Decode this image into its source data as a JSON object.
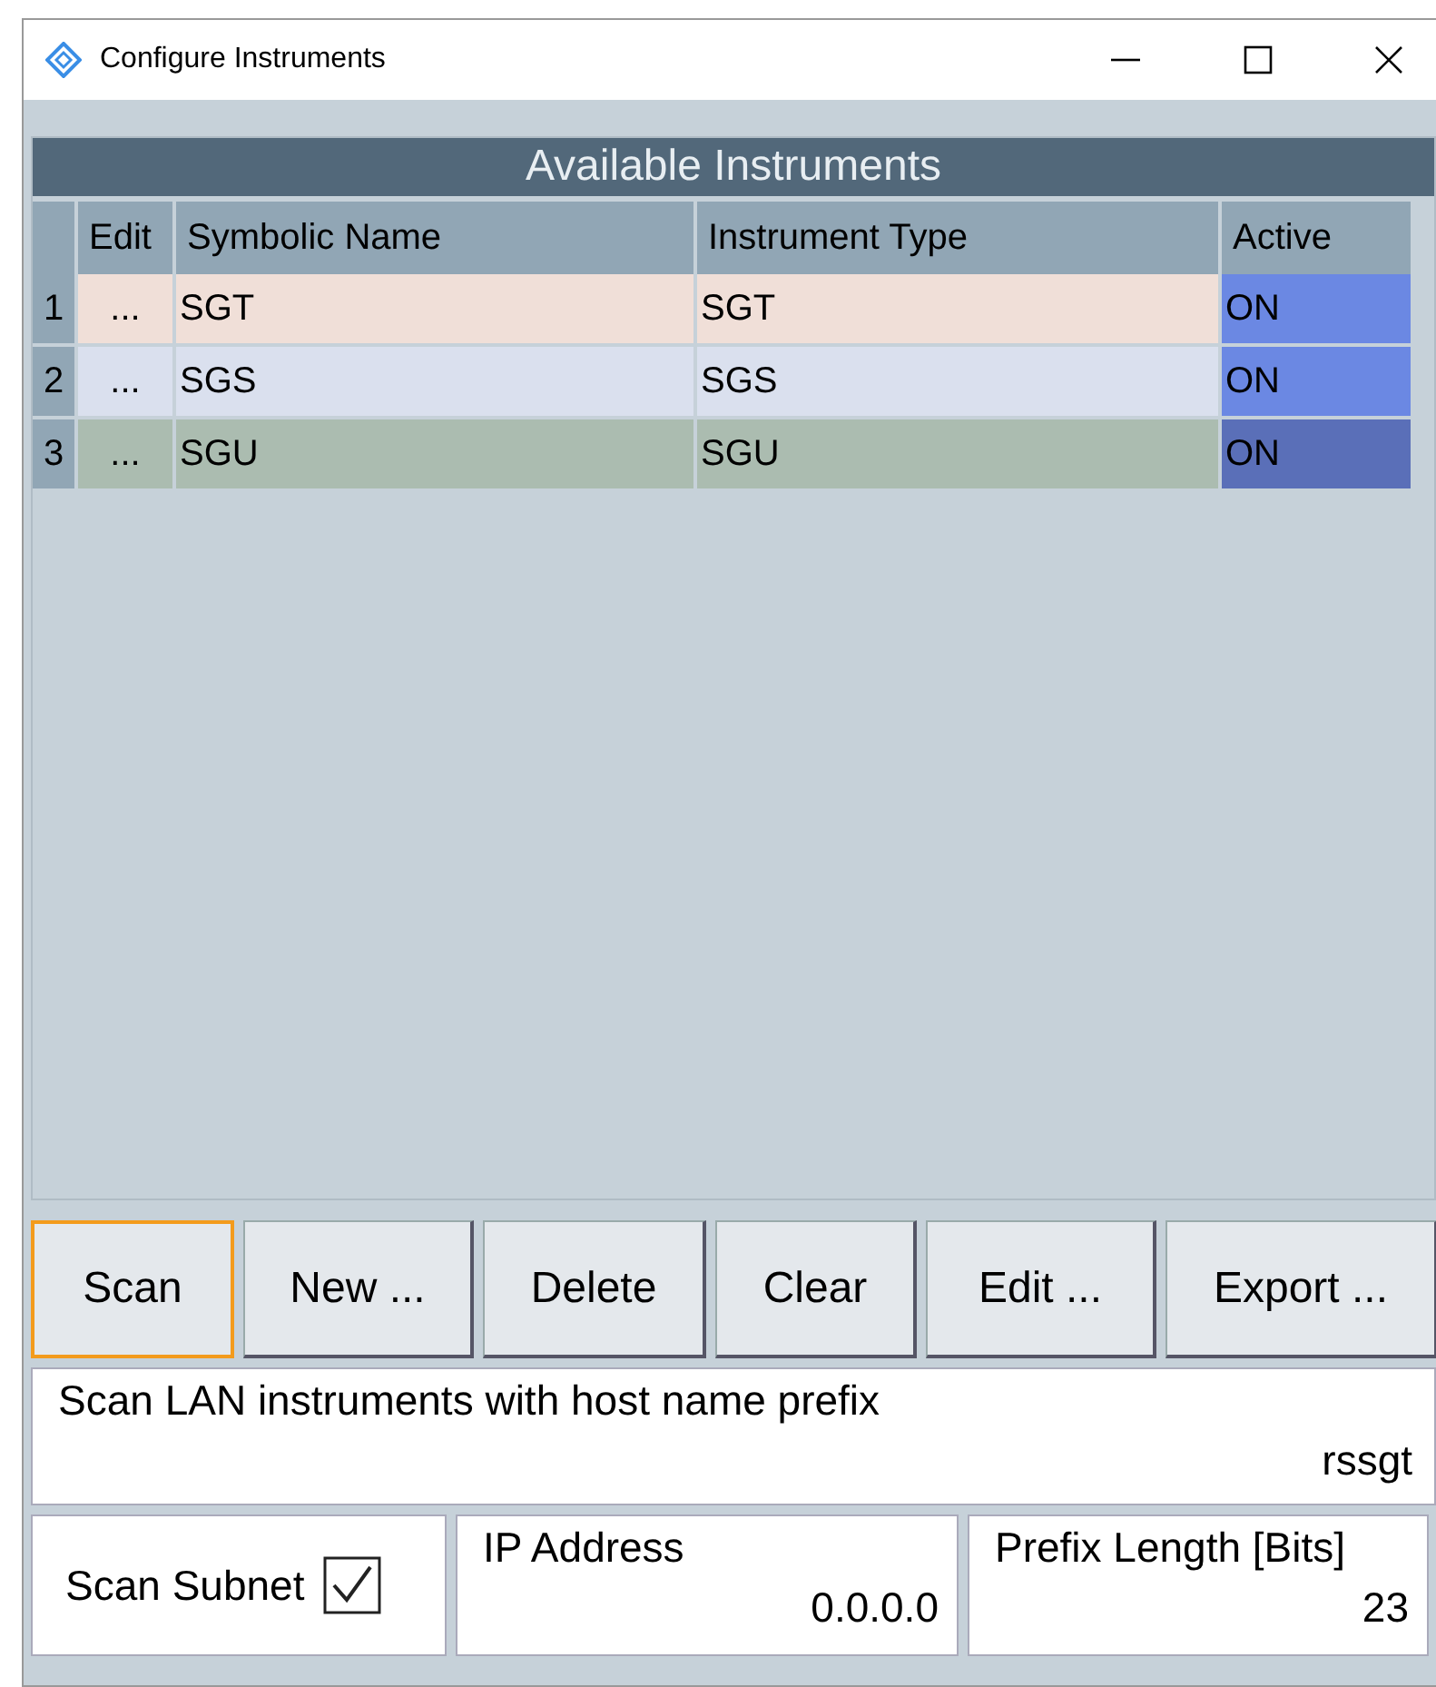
{
  "window": {
    "title": "Configure Instruments"
  },
  "table": {
    "title": "Available Instruments",
    "columns": [
      "Edit",
      "Symbolic Name",
      "Instrument Type",
      "Active"
    ],
    "rows": [
      {
        "index": "1",
        "edit": "...",
        "name": "SGT",
        "type": "SGT",
        "active": "ON",
        "color": "#f0dfd8",
        "selected": false
      },
      {
        "index": "2",
        "edit": "...",
        "name": "SGS",
        "type": "SGS",
        "active": "ON",
        "color": "#dae0ee",
        "selected": false
      },
      {
        "index": "3",
        "edit": "...",
        "name": "SGU",
        "type": "SGU",
        "active": "ON",
        "color": "#abbcb0",
        "selected": true
      }
    ]
  },
  "buttons": [
    {
      "label": "Scan",
      "focused": true
    },
    {
      "label": "New ...",
      "focused": false
    },
    {
      "label": "Delete",
      "focused": false
    },
    {
      "label": "Clear",
      "focused": false
    },
    {
      "label": "Edit ...",
      "focused": false
    },
    {
      "label": "Export ...",
      "focused": false
    }
  ],
  "prefix_field": {
    "label": "Scan LAN instruments with host name prefix",
    "value": "rssgt"
  },
  "scan_subnet": {
    "label": "Scan Subnet",
    "checked": true
  },
  "ip_address": {
    "label": "IP Address",
    "value": "0.0.0.0"
  },
  "prefix_length": {
    "label": "Prefix Length [Bits]",
    "value": "23"
  }
}
